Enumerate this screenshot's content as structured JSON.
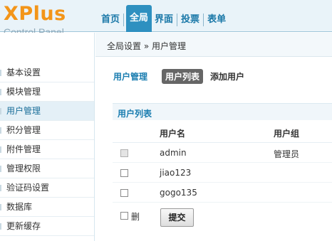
{
  "header": {
    "logo_title": "XPlus",
    "logo_subtitle": "Control Panel",
    "tabs": [
      {
        "label": "首页",
        "active": false
      },
      {
        "label": "全局",
        "active": true
      },
      {
        "label": "界面",
        "active": false
      },
      {
        "label": "投票",
        "active": false
      },
      {
        "label": "表单",
        "active": false
      }
    ]
  },
  "breadcrumb": "全局设置 » 用户管理",
  "sidebar": {
    "items": [
      {
        "label": "基本设置",
        "active": false
      },
      {
        "label": "模块管理",
        "active": false
      },
      {
        "label": "用户管理",
        "active": true
      },
      {
        "label": "积分管理",
        "active": false
      },
      {
        "label": "附件管理",
        "active": false
      },
      {
        "label": "管理权限",
        "active": false
      },
      {
        "label": "验证码设置",
        "active": false
      },
      {
        "label": "数据库",
        "active": false
      },
      {
        "label": "更新缓存",
        "active": false
      }
    ]
  },
  "main": {
    "title": "用户管理",
    "subtabs": [
      {
        "label": "用户列表",
        "active": true
      },
      {
        "label": "添加用户",
        "active": false
      }
    ],
    "section_title": "用户列表",
    "columns": [
      "用户名",
      "用户组"
    ],
    "rows": [
      {
        "name": "admin",
        "group": "管理员",
        "checkbox_disabled": true
      },
      {
        "name": "jiao123",
        "group": "",
        "checkbox_disabled": false
      },
      {
        "name": "gogo135",
        "group": "",
        "checkbox_disabled": false
      }
    ],
    "delete_label": "删",
    "submit_label": "提交"
  },
  "colors": {
    "accent": "#2e90c0",
    "logo": "#f39519",
    "link": "#1a7db0"
  }
}
